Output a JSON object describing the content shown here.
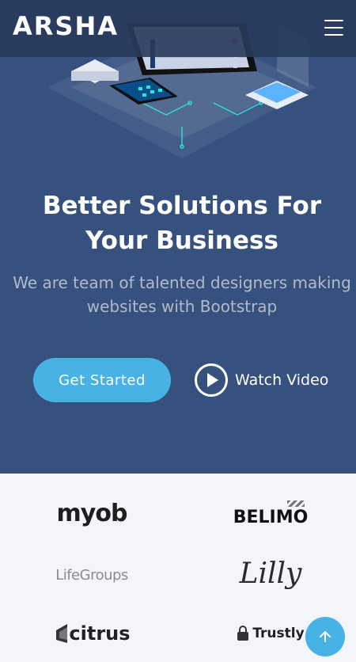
{
  "header": {
    "logo": "ARSHA",
    "menu_icon": "hamburger-menu-icon"
  },
  "hero": {
    "title": "Better Solutions For Your Business",
    "subtitle": "We are team of talented designers making websites with Bootstrap",
    "get_started": "Get Started",
    "watch_video": "Watch Video"
  },
  "clients": {
    "logos": [
      {
        "name": "myob",
        "text": "myob"
      },
      {
        "name": "belimo",
        "text": "BELIMO"
      },
      {
        "name": "lifegroups",
        "text": "LifeGroups"
      },
      {
        "name": "lilly",
        "text": "Lilly"
      },
      {
        "name": "citrus",
        "text": "citrus"
      },
      {
        "name": "trustly",
        "text": "Trustly"
      }
    ]
  },
  "colors": {
    "hero_bg": "#37517e",
    "accent": "#47b2e4",
    "section_bg": "#f3f5fa"
  },
  "back_to_top_icon": "arrow-up-icon"
}
